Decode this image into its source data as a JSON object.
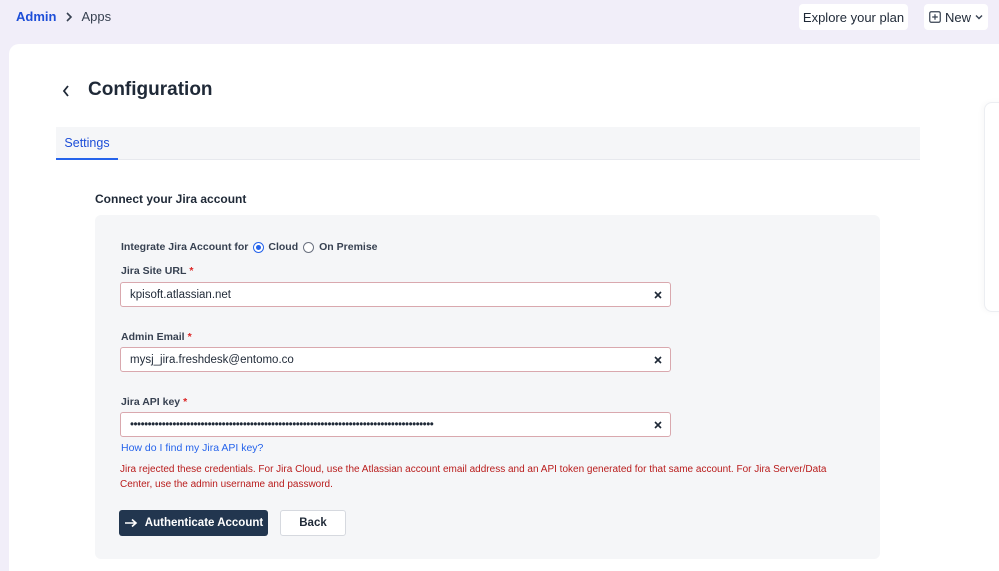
{
  "breadcrumb": {
    "root": "Admin",
    "current": "Apps"
  },
  "header": {
    "explore_label": "Explore your plan",
    "new_label": "New"
  },
  "page": {
    "title": "Configuration"
  },
  "tabs": [
    {
      "label": "Settings",
      "active": true
    }
  ],
  "form": {
    "heading": "Connect your Jira account",
    "integrate_label": "Integrate Jira Account for",
    "options": [
      {
        "label": "Cloud",
        "selected": true
      },
      {
        "label": "On Premise",
        "selected": false
      }
    ],
    "site_url": {
      "label": "Jira Site URL",
      "required_marker": "*",
      "value": "kpisoft.atlassian.net"
    },
    "admin_email": {
      "label": "Admin Email",
      "required_marker": "*",
      "value": "mysj_jira.freshdesk@entomo.co"
    },
    "api_key": {
      "label": "Jira API key",
      "required_marker": "*",
      "value": "••••••••••••••••••••••••••••••••••••••••••••••••••••••••••••••••••••••••••••••••••••••"
    },
    "help_link": "How do I find my Jira API key?",
    "error": "Jira rejected these credentials. For Jira Cloud, use the Atlassian account email address and an API token generated for that same account. For Jira Server/Data Center, use the admin username and password.",
    "authenticate_label": "Authenticate Account",
    "back_label": "Back"
  },
  "colors": {
    "accent": "#2563eb",
    "primary_button": "#22364f",
    "error": "#b91c1c",
    "page_bg": "#f1eef9"
  },
  "icons": [
    "chevron-right-icon",
    "plus-square-icon",
    "chevron-down-icon",
    "chevron-left-icon",
    "clear-icon",
    "arrow-right-icon"
  ]
}
